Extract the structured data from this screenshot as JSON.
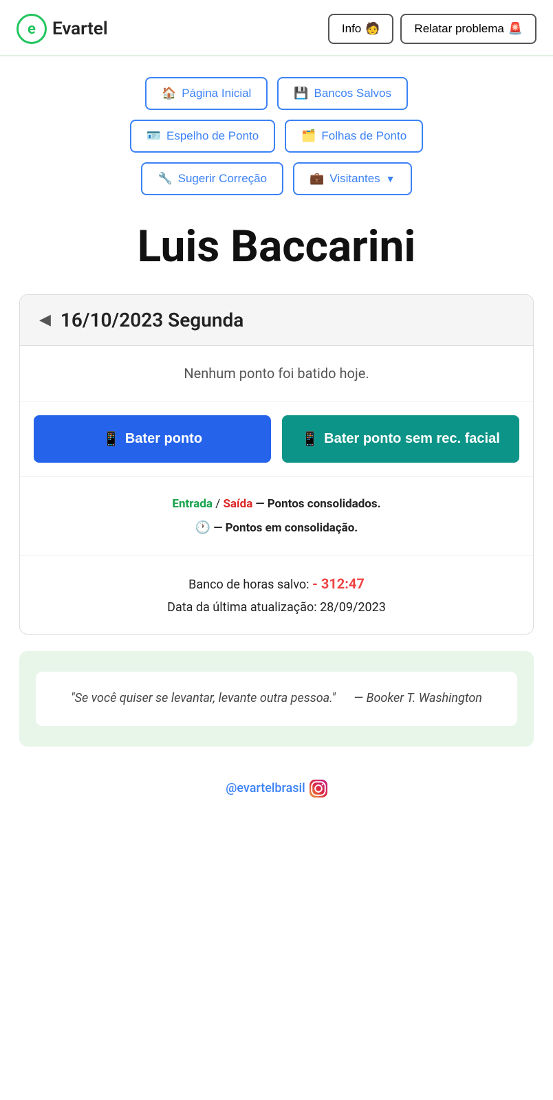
{
  "header": {
    "logo_letter": "e",
    "app_name": "Evartel",
    "info_label": "Info",
    "info_emoji": "🧑",
    "report_label": "Relatar problema",
    "report_emoji": "🚨"
  },
  "nav": {
    "pagina_inicial": "Página Inicial",
    "pagina_inicial_emoji": "🏠",
    "bancos_salvos": "Bancos Salvos",
    "bancos_salvos_emoji": "💾",
    "espelho_ponto": "Espelho de Ponto",
    "espelho_ponto_emoji": "🪪",
    "folhas_ponto": "Folhas de Ponto",
    "folhas_ponto_emoji": "🗂️",
    "sugerir_correcao": "Sugerir Correção",
    "sugerir_correcao_emoji": "🔧",
    "visitantes": "Visitantes",
    "visitantes_emoji": "💼"
  },
  "user": {
    "name": "Luis Baccarini"
  },
  "date_card": {
    "arrow_left": "◀",
    "date_text": "16/10/2023 Segunda",
    "no_point_message": "Nenhum ponto foi batido hoje.",
    "bater_ponto_label": "Bater ponto",
    "bater_ponto_emoji": "📱",
    "bater_sem_label": "Bater ponto sem rec. facial",
    "bater_sem_emoji": "📱",
    "entrada_label": "Entrada",
    "saida_label": "Saída",
    "pontos_consolidados": "— Pontos consolidados.",
    "clock_emoji": "🕐",
    "pontos_consolidacao": "— Pontos em consolidação.",
    "banco_horas_label": "Banco de horas salvo:",
    "banco_horas_value": "- 312:47",
    "ultima_atualizacao_label": "Data da última atualização:",
    "ultima_atualizacao_date": "28/09/2023"
  },
  "quote": {
    "text": "\"Se você quiser se levantar, levante outra pessoa.\"",
    "author": "— Booker T. Washington"
  },
  "footer": {
    "instagram_handle": "@evartelbrasil"
  }
}
